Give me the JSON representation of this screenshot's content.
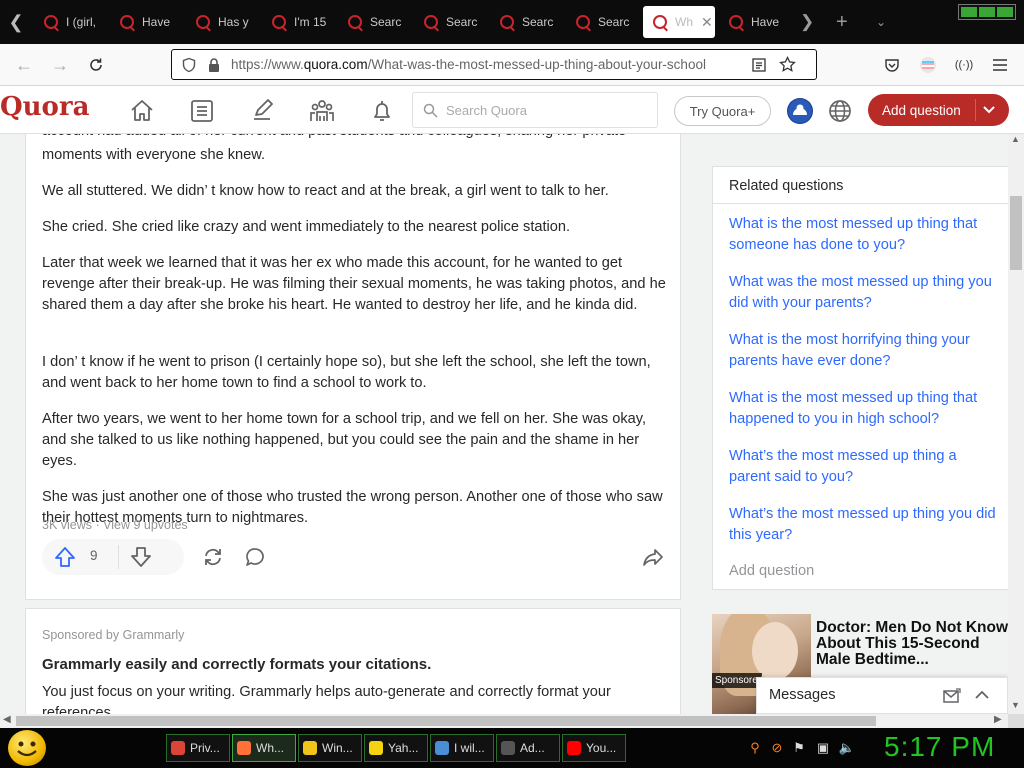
{
  "browser": {
    "tabs": [
      {
        "label": "I (girl,",
        "active": false
      },
      {
        "label": "Have",
        "active": false
      },
      {
        "label": "Has y",
        "active": false
      },
      {
        "label": "I'm 15",
        "active": false
      },
      {
        "label": "Searc",
        "active": false
      },
      {
        "label": "Searc",
        "active": false
      },
      {
        "label": "Searc",
        "active": false
      },
      {
        "label": "Searc",
        "active": false
      },
      {
        "label": "Wh",
        "active": true
      },
      {
        "label": "Have",
        "active": false
      }
    ],
    "url_prefix": "https://www.",
    "url_domain": "quora.com",
    "url_path": "/What-was-the-most-messed-up-thing-about-your-school"
  },
  "quora_header": {
    "logo": "Quora",
    "search_placeholder": "Search Quora",
    "try_button": "Try Quora+",
    "add_question_button": "Add question"
  },
  "answer": {
    "cut_line_1": "account had added all of her current and past students and colleagues, sharing her private",
    "paragraphs": [
      "moments with everyone she knew.",
      "We all stuttered. We didn’ t know how to react and at the break, a girl went to talk to her.",
      "She cried. She cried like crazy and went immediately to the nearest police station.",
      "Later that week we learned that it was her ex who made this account, for he wanted to get revenge after their break-up. He was filming their sexual moments, he was taking photos, and he shared them a day after she broke his heart. He wanted to destroy her life, and he kinda did.",
      "I don’ t know if he went to prison (I certainly hope so), but she left the school, she left the town, and went back to her home town to find a school to work to.",
      "After two years, we went to her home town for a school trip, and we fell on her. She was okay, and she talked to us like nothing happened, but you could see the pain and the shame in her eyes.",
      "She was just another one of those who trusted the wrong person. Another one of those who saw their hottest moments turn to nightmares."
    ],
    "views": "3K views",
    "separator": " · ",
    "upvotes_link": "View 9 upvotes",
    "upvote_count": "9"
  },
  "sponsored": {
    "label": "Sponsored by Grammarly",
    "title": "Grammarly easily and correctly formats your citations.",
    "body": "You just focus on your writing. Grammarly helps auto-generate and correctly format your references."
  },
  "related": {
    "title": "Related questions",
    "items": [
      "What is the most messed up thing that someone has done to you?",
      "What was the most messed up thing you did with your parents?",
      "What is the most horrifying thing your parents have ever done?",
      "What is the most messed up thing that happened to you in high school?",
      "What’s the most messed up thing a parent said to you?",
      "What’s the most messed up thing you did this year?"
    ],
    "add_question": "Add question"
  },
  "ad": {
    "tag": "Sponsored",
    "title": "Doctor: Men Do Not Know About This 15-Second Male Bedtime..."
  },
  "messages": {
    "title": "Messages"
  },
  "taskbar": {
    "items": [
      {
        "label": "Priv...",
        "color": "#db4437"
      },
      {
        "label": "Wh...",
        "color": "#ff7139"
      },
      {
        "label": "Win...",
        "color": "#f0c419"
      },
      {
        "label": "Yah...",
        "color": "#f5d313"
      },
      {
        "label": "I wil...",
        "color": "#4a8fd6"
      },
      {
        "label": "Ad...",
        "color": "#555555"
      },
      {
        "label": "You...",
        "color": "#ff0000"
      }
    ],
    "clock": "5:17 PM"
  },
  "colors": {
    "quora_red": "#b92b27",
    "link_blue": "#2e69ff",
    "clock_green": "#21c521"
  }
}
